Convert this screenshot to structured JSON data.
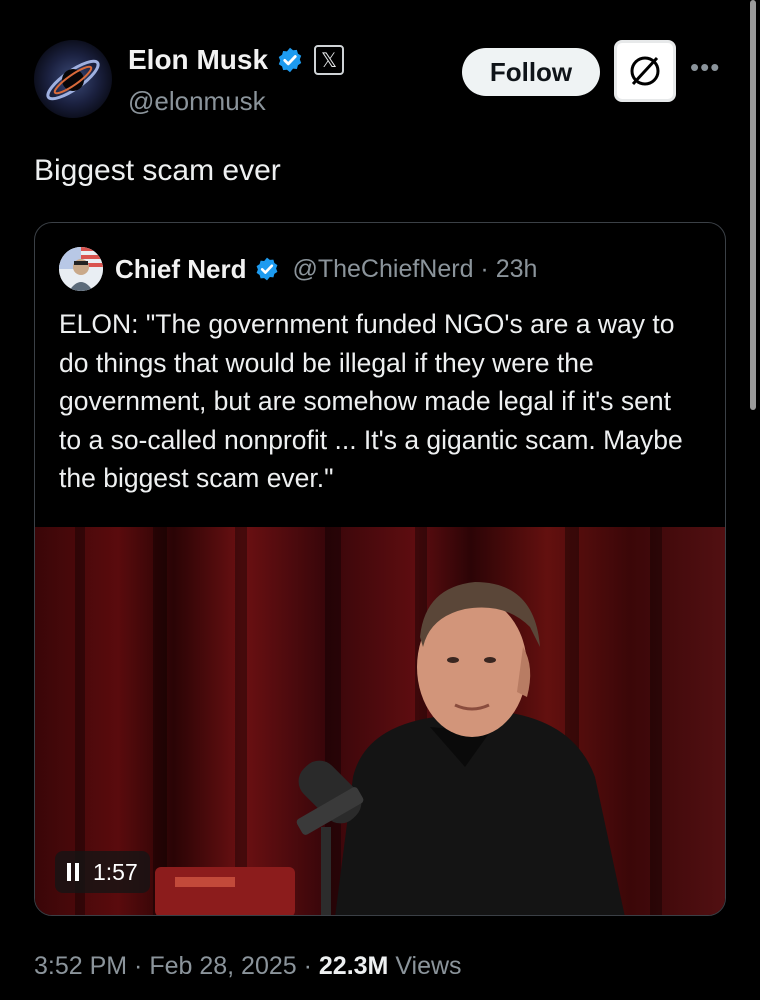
{
  "author": {
    "name": "Elon Musk",
    "handle": "@elonmusk",
    "affiliation_icon": "x-logo-badge"
  },
  "actions": {
    "follow_label": "Follow",
    "grok_icon": "slash-circle-icon",
    "more_icon": "more-dots-icon"
  },
  "tweet": {
    "text": "Biggest scam ever"
  },
  "quote": {
    "name": "Chief Nerd",
    "handle_time": "@TheChiefNerd · 23h",
    "text": "ELON: \"The government funded NGO's are a way to do things that would be illegal if they were the government, but are somehow made legal if it's sent to a so-called nonprofit ... It's a gigantic scam. Maybe the biggest scam ever.\"",
    "video_time": "1:57"
  },
  "meta": {
    "time_date": "3:52 PM · Feb 28, 2025 · ",
    "views_count": "22.3M",
    "views_label": " Views"
  },
  "colors": {
    "verified": "#1d9bf0",
    "background": "#000000",
    "muted_text": "#8b949b"
  }
}
